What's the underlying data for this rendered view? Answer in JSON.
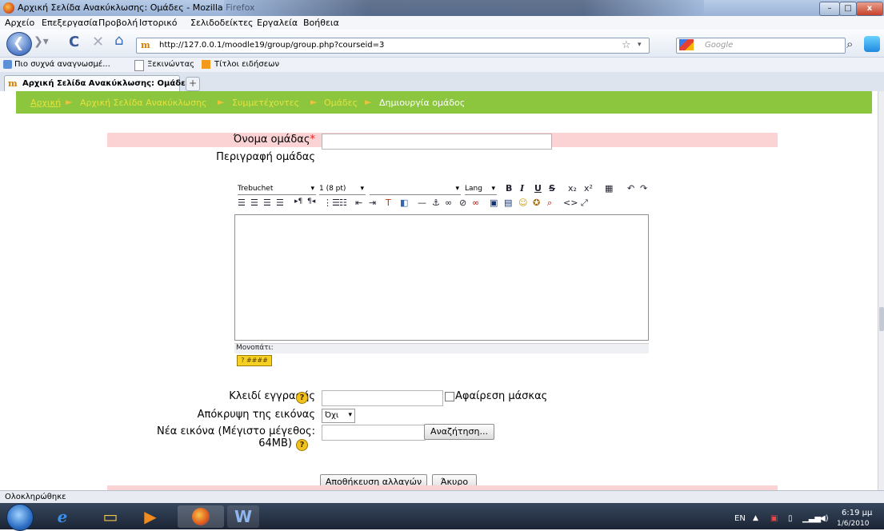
{
  "window": {
    "title": "Αρχική Σελίδα Ανακύκλωσης: Ομάδες - Mozilla Firefox",
    "min": "–",
    "max": "□",
    "close": "x"
  },
  "menubar": [
    "Αρχείο",
    "Επεξεργασία",
    "Προβολή",
    "Ιστορικό",
    "Σελιδοδείκτες",
    "Εργαλεία",
    "Βοήθεια"
  ],
  "nav": {
    "url": "http://127.0.0.1/moodle19/group/group.php?courseid=3",
    "favicon": "m",
    "search_placeholder": "Google",
    "back_glyph": "❮",
    "reload_glyph": "C",
    "stop_glyph": "✕",
    "home_glyph": "⌂",
    "star_glyph": "☆",
    "search_glyph": "⌕"
  },
  "bookmarks": [
    "Πιο συχνά αναγνωσμέ...",
    "Ξεκινώντας",
    "Τίτλοι ειδήσεων"
  ],
  "tab": {
    "label": "Αρχική Σελίδα Ανακύκλωσης: Ομάδες",
    "newtab": "+"
  },
  "breadcrumb": {
    "items": [
      "Αρχική",
      "Αρχική Σελίδα Ανακύκλωσης",
      "Συμμετέχοντες",
      "Ομάδες"
    ],
    "current": "Δημιουργία ομάδος",
    "separator": "►"
  },
  "form": {
    "group_name_label": "Όνομα ομάδας",
    "required_mark": "*",
    "group_name_value": "",
    "description_label": "Περιγραφή ομάδας",
    "editor": {
      "font": "Trebuchet",
      "size": "1 (8 pt)",
      "format": "",
      "lang": "Lang",
      "path_label": "Μονοπάτι:",
      "help_label": "? ####"
    },
    "enrol_key_label": "Κλειδί εγγραφής",
    "enrol_key_value": "",
    "unmask_label": "Αφαίρεση μάσκας",
    "hide_picture_label": "Απόκρυψη της εικόνας",
    "hide_picture_value": "Όχι",
    "new_picture_label_1": "Νέα εικόνα (Μέγιστο μέγεθος:",
    "new_picture_label_2": "64MB)",
    "browse_button": "Αναζήτηση...",
    "save_button": "Αποθήκευση αλλαγών",
    "cancel_button": "Άκυρο",
    "help_glyph": "?"
  },
  "status": {
    "text": "Ολοκληρώθηκε"
  },
  "taskbar": {
    "lang": "EN",
    "time": "6:19 μμ",
    "date": "1/6/2010"
  },
  "colors": {
    "breadcrumb_bg": "#8cc63f",
    "required_row_bg": "#fcd3d5"
  }
}
